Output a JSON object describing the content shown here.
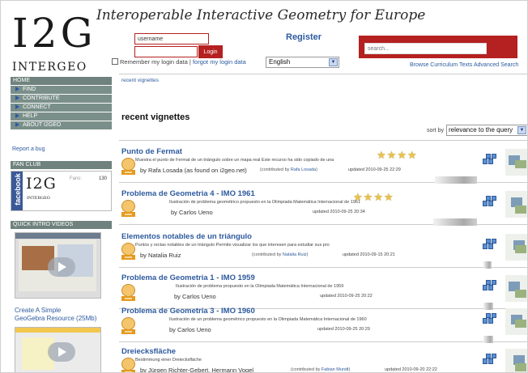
{
  "header": {
    "logo_text": "I2G",
    "logo_word": "INTERGEO",
    "site_title": "Interoperable Interactive Geometry for Europe",
    "username_value": "username",
    "login_label": "Login",
    "register_label": "Register",
    "remember_text": "Remember my login data",
    "separator": "|",
    "forgot_text": "forgot my login data",
    "language": "English",
    "search_placeholder": "search...",
    "browse_link": "Browse Curriculum Texts",
    "advanced_link": "Advanced Search"
  },
  "nav": {
    "items": [
      {
        "label": "HOME",
        "sub": false
      },
      {
        "label": "FIND",
        "sub": true
      },
      {
        "label": "CONTRIBUTE",
        "sub": true
      },
      {
        "label": "CONNECT",
        "sub": true
      },
      {
        "label": "HELP",
        "sub": true
      },
      {
        "label": "ABOUT I2GEO",
        "sub": true
      }
    ]
  },
  "sidebar": {
    "report_bug": "Report a bug",
    "fan_club_header": "FAN CLUB",
    "facebook_label": "facebook",
    "fan_logo": "I2G",
    "fan_word": "INTERGEO",
    "fans_label": "Fans:",
    "fans_count": "130",
    "videos_header": "QUICK INTRO VIDEOS",
    "video_caption_line1": "Create A Simple",
    "video_caption_line2": "GeoGebra Resource (25Mb)"
  },
  "main": {
    "breadcrumb": "recent vignettes",
    "title": "recent vignettes",
    "sort_label": "sort by",
    "sort_value": "relevance to the query",
    "contributed_by_label": "(contributed by",
    "contributed_close": ")",
    "updated_label": "updated",
    "results": [
      {
        "title": "Punto de Fermat",
        "desc": "Muestra el punto de Fermat de un triángulo sobre un mapa real Este recurso ha sido copiado de una",
        "author": "by Rafa Losada (as found on i2geo.net)",
        "contributor": "Rafa Losada",
        "updated": "2010-09-25 22:29",
        "stars": 4
      },
      {
        "title": "Problema de Geometria 4 - IMO 1961",
        "desc": "Ilustración de problema geométrico propuesto en la Olimpiada Matemática Internacional de 1961",
        "author": "by Carlos Ueno",
        "contributor": "",
        "updated": "2010-09-25 20:34",
        "stars": 4
      },
      {
        "title": "Elementos notables de un triángulo",
        "desc": "Puntos y rectas notables de un triángulo Permite visualizar los que interesen para estudiar sus pro",
        "author": "by Natalia Ruiz",
        "contributor": "Natalia Ruiz",
        "updated": "2010-09-15 20:21",
        "stars": 0
      },
      {
        "title": "Problema de Geometria 1 - IMO 1959",
        "desc": "Ilustración de problema propuesto en la Olimpiada Matemática Internacional de 1959",
        "author": "by Carlos Ueno",
        "contributor": "",
        "updated": "2010-09-25 20:22",
        "stars": 0
      },
      {
        "title": "Problema de Geometria 3 - IMO 1960",
        "desc": "Ilustración de un problema geométrico propuesto en la Olimpiada Matemática Internacional de 1960",
        "author": "by Carlos Ueno",
        "contributor": "",
        "updated": "2010-09-25 20:29",
        "stars": 0
      },
      {
        "title": "Dreiecksfläche",
        "desc": "Bestimmung einer Dreiecksfläche",
        "author": "by Jürgen Richter-Gebert, Hermann Vogel",
        "contributor": "Fabian Mundt",
        "updated": "2010-09-20 22:22",
        "stars": 0
      }
    ]
  },
  "colors": {
    "brand_red": "#b52020",
    "link_blue": "#2d5a9e",
    "nav_green": "#6f827d",
    "star_gold": "#e8c24c",
    "facebook_blue": "#3b5998"
  },
  "icons": {
    "resource_badge": "www-globe-icon",
    "cluster": "cluster-blocks-icon",
    "star": "star-icon",
    "nav_arrow": "triangle-right-icon",
    "select_arrow": "chevron-down-icon"
  }
}
